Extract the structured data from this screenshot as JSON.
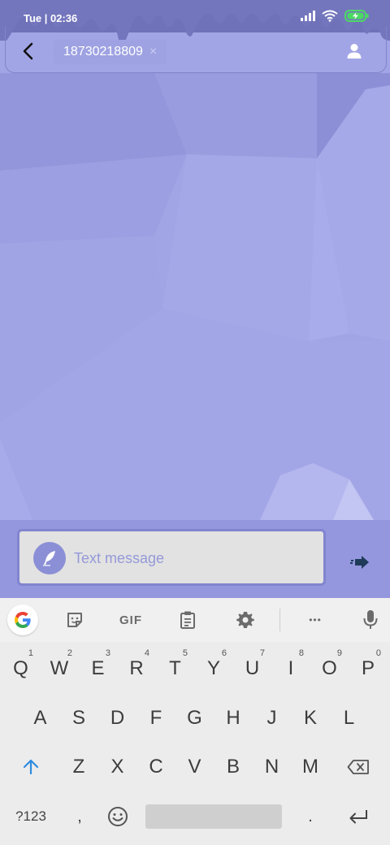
{
  "status_bar": {
    "time": "Tue | 02:36",
    "icons": [
      "signal-icon",
      "wifi-icon",
      "battery-charging-icon"
    ]
  },
  "header": {
    "recipient": "18730218809",
    "remove_glyph": "×"
  },
  "compose": {
    "placeholder": "Text message"
  },
  "keyboard": {
    "toolbar": {
      "gif_label": "GIF",
      "more_glyph": "•••"
    },
    "row1": [
      {
        "key": "Q",
        "hint": "1"
      },
      {
        "key": "W",
        "hint": "2"
      },
      {
        "key": "E",
        "hint": "3"
      },
      {
        "key": "R",
        "hint": "4"
      },
      {
        "key": "T",
        "hint": "5"
      },
      {
        "key": "Y",
        "hint": "6"
      },
      {
        "key": "U",
        "hint": "7"
      },
      {
        "key": "I",
        "hint": "8"
      },
      {
        "key": "O",
        "hint": "9"
      },
      {
        "key": "P",
        "hint": "0"
      }
    ],
    "row2": [
      "A",
      "S",
      "D",
      "F",
      "G",
      "H",
      "J",
      "K",
      "L"
    ],
    "row3": [
      "Z",
      "X",
      "C",
      "V",
      "B",
      "N",
      "M"
    ],
    "row4": {
      "symbols_label": "?123",
      "comma": ",",
      "period": "."
    }
  },
  "colors": {
    "background": "#a2a5e5",
    "compose_bar": "#9497dd",
    "accent": "#8b8fd6",
    "keyboard": "#ececec",
    "shift_blue": "#2f8ce0"
  }
}
